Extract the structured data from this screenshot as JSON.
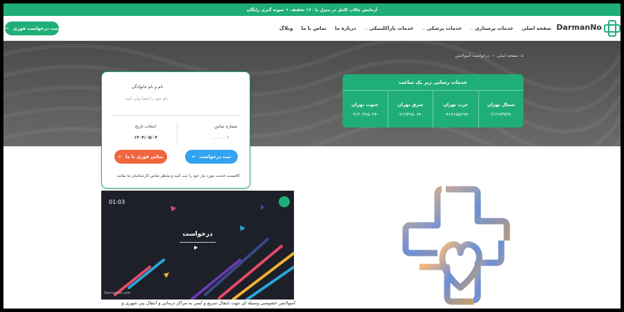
{
  "promo": "آزمایش چکاپ کامل در منزل با ۶۰٪ تخفیف + نمونه گیری رایگان",
  "header": {
    "cta_label": "ثبت درخواست فوری",
    "logo_text": "DarmanNo",
    "menu": [
      "صفحه اصلی",
      "خدمات پرستاری",
      "خدمات پزشکی",
      "خدمات پاراکلینیکی",
      "درباره ما",
      "تماس با ما",
      "وبلاگ"
    ]
  },
  "breadcrumb": {
    "home": "صفحه اصلی",
    "sep": "›",
    "current": "درخواست آمبولانس"
  },
  "service_panel": {
    "title": "خدمات رسانی زیر یک ساعت",
    "regions": [
      {
        "name": "شمال تهران",
        "phone": "۰۲۱۲۶۳۷۲۷۰"
      },
      {
        "name": "غرب تهران",
        "phone": "۰۹۱۴۶۸۵۶۹۹"
      },
      {
        "name": "شرق تهران",
        "phone": "۰۹۱۲۳۶۵۰۶۴۰"
      },
      {
        "name": "جنوب تهران",
        "phone": "۰۹۱۲۰۳۶۵۰۲۴۰"
      }
    ]
  },
  "form": {
    "name_label": "نام و نام خانوادگی",
    "name_placeholder": "نام خود را اینجا وارد کنید",
    "phone_label": "شماره تماس",
    "phone_placeholder": "۰۹.........",
    "date_label": "انتخاب تاریخ",
    "date_value": "۱۴۰۴/۰۵/۰۴",
    "submit_label": "ثبت درخواست",
    "call_label": "تماس فوری با ما",
    "note": "کافیست خدمت مورد نیاز خود را ثبت کنید و منتظر تماس کارشناسان ما بمانید."
  },
  "video": {
    "time": "01:03",
    "title": "درخواست",
    "brand": "Darmanno.com"
  },
  "description": "آمبولانس خصوصی وسیله ای جهت انتقال سریع و ایمن به مراکز درمانی و انتقال بین شهری و",
  "colors": {
    "brand": "#1fae77",
    "blue": "#34a3f0",
    "orange": "#f0663e"
  }
}
